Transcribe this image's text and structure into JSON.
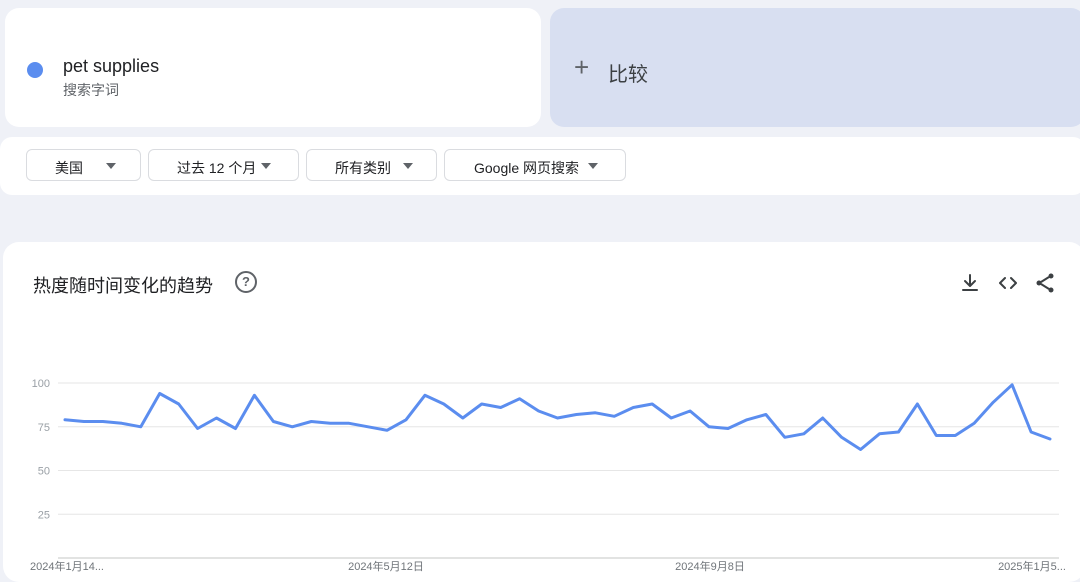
{
  "search_term": {
    "name": "pet supplies",
    "subtitle": "搜索字词",
    "color": "#5b8def"
  },
  "compare": {
    "plus": "+",
    "label": "比较"
  },
  "filters": {
    "region": "美国",
    "time_range": "过去 12 个月",
    "category": "所有类别",
    "source": "Google 网页搜索"
  },
  "chart": {
    "title": "热度随时间变化的趋势",
    "help_icon": "help-circle-icon",
    "tools": [
      "download-icon",
      "embed-code-icon",
      "share-icon"
    ]
  },
  "chart_data": {
    "type": "line",
    "y_ticks": [
      "100",
      "75",
      "50",
      "25"
    ],
    "x_ticks": [
      "2024年1月14...",
      "2024年5月12日",
      "2024年9月8日",
      "2025年1月5..."
    ],
    "ylim": [
      0,
      100
    ],
    "grid": true,
    "line_color": "#5b8def",
    "series": [
      {
        "values": [
          79,
          78,
          78,
          77,
          75,
          94,
          88,
          74,
          80,
          74,
          93,
          78,
          75,
          78,
          77,
          77,
          75,
          73,
          79,
          93,
          88,
          80,
          88,
          86,
          91,
          84,
          80,
          82,
          83,
          81,
          86,
          88,
          80,
          84,
          75,
          74,
          79,
          82,
          69,
          71,
          80,
          69,
          62,
          71,
          72,
          88,
          70,
          70,
          77,
          89,
          99,
          72,
          68
        ]
      }
    ]
  }
}
